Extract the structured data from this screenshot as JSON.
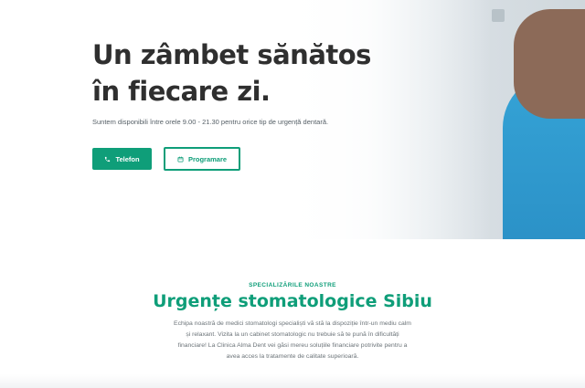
{
  "hero": {
    "title_line1": "Un zâmbet sănătos",
    "title_line2": "în fiecare zi.",
    "subtitle": "Suntem disponibili între orele 9.00 - 21.30 pentru orice tip de urgență dentară.",
    "phone_button": "Telefon",
    "appointment_button": "Programare"
  },
  "specialties": {
    "eyebrow": "SPECIALIZĂRILE NOASTRE",
    "title": "Urgențe stomatologice Sibiu",
    "body": "Echipa noastră de medici stomatologi specialiști vă stă la dispoziție într-un mediu calm și relaxant. Vizita la un cabinet stomatologic nu trebuie să te pună în dificultăți financiare! La Clinica Alma Dent vei găsi mereu soluțiile financiare potrivite pentru a avea acces la tratamente de calitate superioară."
  },
  "colors": {
    "accent": "#0f9e79",
    "heading": "#2f2f2f",
    "text": "#6b7378"
  },
  "icons": {
    "phone_button": "phone-icon",
    "appointment_button": "calendar-icon"
  }
}
